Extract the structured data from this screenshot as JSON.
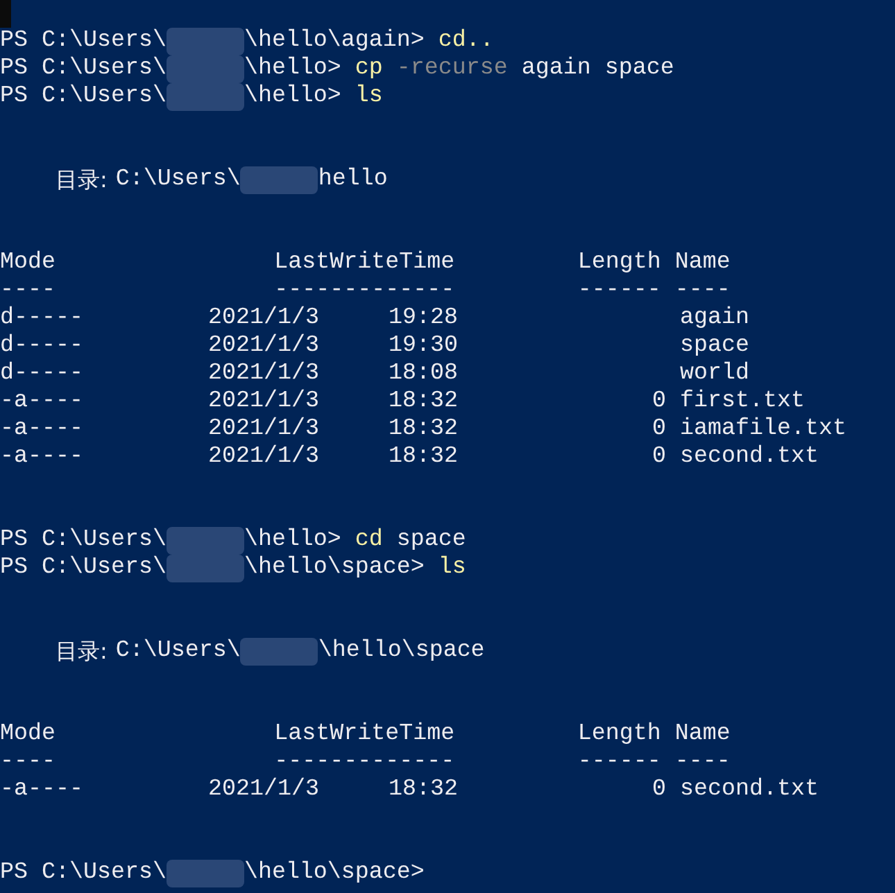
{
  "terminal": {
    "blocks": [
      {
        "kind": "prompt",
        "prefix": "PS C:\\Users\\",
        "suffix": "\\hello\\again>",
        "tokens": [
          {
            "kind": "command",
            "text": "cd.."
          }
        ]
      },
      {
        "kind": "prompt",
        "prefix": "PS C:\\Users\\",
        "suffix": "\\hello>",
        "tokens": [
          {
            "kind": "command",
            "text": "cp"
          },
          {
            "kind": "parameter",
            "text": "-recurse"
          },
          {
            "kind": "argument",
            "text": "again space"
          }
        ]
      },
      {
        "kind": "prompt",
        "prefix": "PS C:\\Users\\",
        "suffix": "\\hello>",
        "tokens": [
          {
            "kind": "command",
            "text": "ls"
          }
        ]
      },
      {
        "kind": "listing",
        "directory_label": "目录:",
        "prefix": "C:\\Users\\",
        "suffix": "hello",
        "columns": [
          {
            "label": "Mode",
            "rule": "----"
          },
          {
            "label": "LastWriteTime",
            "rule": "-------------"
          },
          {
            "label": "Length",
            "rule": "------"
          },
          {
            "label": "Name",
            "rule": "----"
          }
        ],
        "rows": [
          {
            "mode": "d-----",
            "date": "2021/1/3",
            "time": "19:28",
            "length": "",
            "name": "again"
          },
          {
            "mode": "d-----",
            "date": "2021/1/3",
            "time": "19:30",
            "length": "",
            "name": "space"
          },
          {
            "mode": "d-----",
            "date": "2021/1/3",
            "time": "18:08",
            "length": "",
            "name": "world"
          },
          {
            "mode": "-a----",
            "date": "2021/1/3",
            "time": "18:32",
            "length": "0",
            "name": "first.txt"
          },
          {
            "mode": "-a----",
            "date": "2021/1/3",
            "time": "18:32",
            "length": "0",
            "name": "iamafile.txt"
          },
          {
            "mode": "-a----",
            "date": "2021/1/3",
            "time": "18:32",
            "length": "0",
            "name": "second.txt"
          }
        ]
      },
      {
        "kind": "prompt",
        "prefix": "PS C:\\Users\\",
        "suffix": "\\hello>",
        "tokens": [
          {
            "kind": "command",
            "text": "cd"
          },
          {
            "kind": "argument",
            "text": "space"
          }
        ]
      },
      {
        "kind": "prompt",
        "prefix": "PS C:\\Users\\",
        "suffix": "\\hello\\space>",
        "tokens": [
          {
            "kind": "command",
            "text": "ls"
          }
        ]
      },
      {
        "kind": "listing",
        "directory_label": "目录:",
        "prefix": "C:\\Users\\",
        "suffix": "\\hello\\space",
        "columns": [
          {
            "label": "Mode",
            "rule": "----"
          },
          {
            "label": "LastWriteTime",
            "rule": "-------------"
          },
          {
            "label": "Length",
            "rule": "------"
          },
          {
            "label": "Name",
            "rule": "----"
          }
        ],
        "rows": [
          {
            "mode": "-a----",
            "date": "2021/1/3",
            "time": "18:32",
            "length": "0",
            "name": "second.txt"
          }
        ]
      },
      {
        "kind": "prompt",
        "prefix": "PS C:\\Users\\",
        "suffix": "\\hello\\space>"
      }
    ]
  }
}
